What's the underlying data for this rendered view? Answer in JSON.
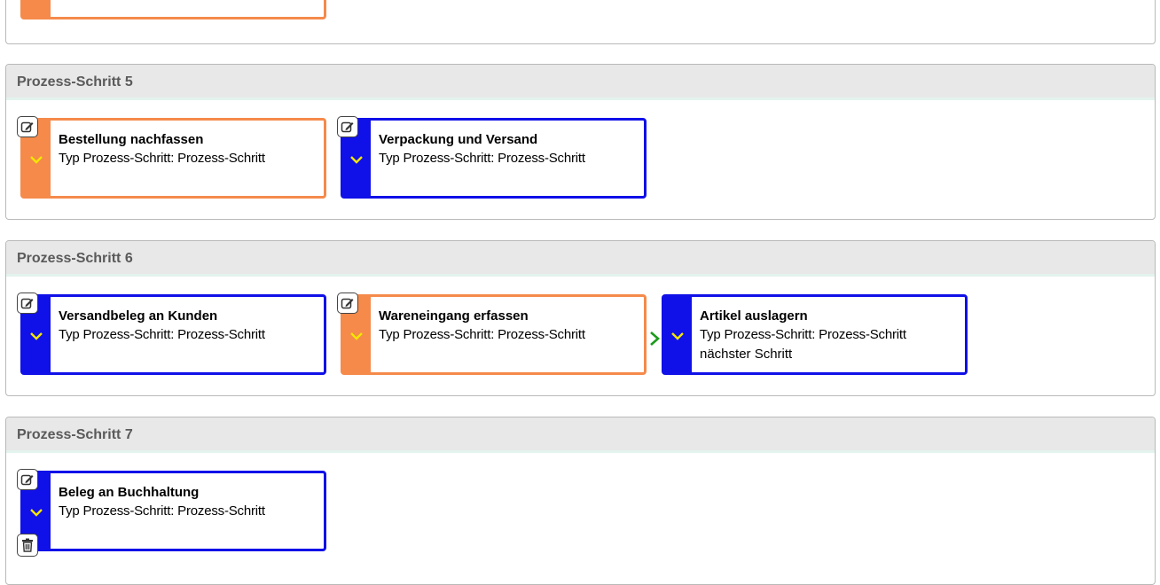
{
  "colors": {
    "orange": "#f58a4b",
    "blue": "#1010e8",
    "chevron_yellow": "#f3e600",
    "arrow_green": "#1b9a1b"
  },
  "icons": {
    "edit": "edit-icon",
    "expand": "chevron-down-icon",
    "delete": "trash-icon",
    "next": "chevron-right-icon"
  },
  "steps": [
    {
      "title": "Prozess-Schritt 5",
      "cards": [
        {
          "title": "Bestellung nachfassen",
          "type": "Typ Prozess-Schritt: Prozess-Schritt",
          "color": "orange"
        },
        {
          "title": "Verpackung und Versand",
          "type": "Typ Prozess-Schritt: Prozess-Schritt",
          "color": "blue"
        }
      ]
    },
    {
      "title": "Prozess-Schritt 6",
      "cards": [
        {
          "title": "Versandbeleg an Kunden",
          "type": "Typ Prozess-Schritt: Prozess-Schritt",
          "color": "blue"
        },
        {
          "title": "Wareneingang erfassen",
          "type": "Typ Prozess-Schritt: Prozess-Schritt",
          "color": "orange"
        },
        {
          "title": "Artikel auslagern",
          "type": "Typ Prozess-Schritt: Prozess-Schritt",
          "extra": "nächster Schritt",
          "color": "blue"
        }
      ]
    },
    {
      "title": "Prozess-Schritt 7",
      "cards": [
        {
          "title": "Beleg an Buchhaltung",
          "type": "Typ Prozess-Schritt: Prozess-Schritt",
          "color": "blue"
        }
      ]
    }
  ]
}
